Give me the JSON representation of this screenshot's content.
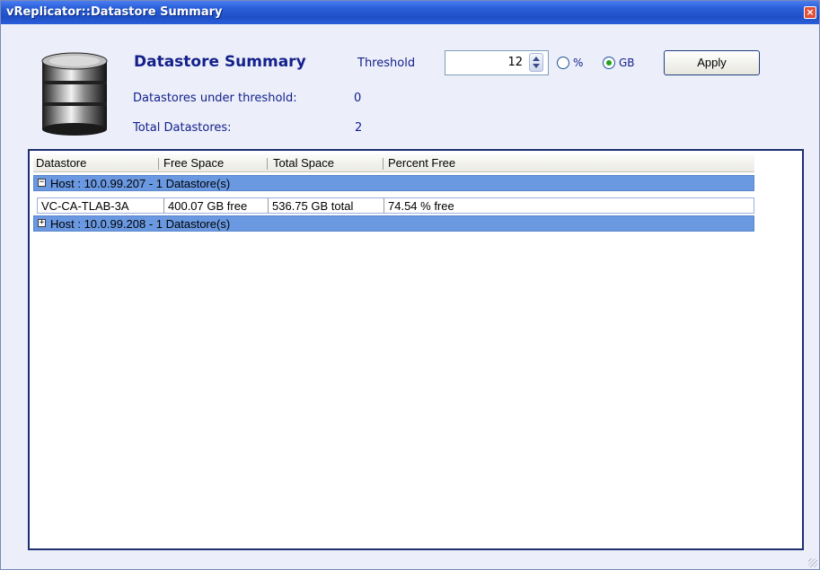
{
  "window": {
    "title": "vReplicator::Datastore Summary",
    "close_symbol": "×"
  },
  "summary": {
    "title": "Datastore Summary",
    "threshold_label": "Threshold",
    "threshold_value": "12",
    "percent_option_label": "%",
    "gb_option_label": "GB",
    "selected_unit": "GB",
    "apply_label": "Apply",
    "under_threshold_label": "Datastores under threshold:",
    "under_threshold_value": "0",
    "total_label": "Total Datastores:",
    "total_value": "2"
  },
  "grid": {
    "columns": [
      "Datastore",
      "Free Space",
      "Total Space",
      "Percent Free"
    ],
    "groups": [
      {
        "label": "Host : 10.0.99.207 - 1 Datastore(s)",
        "expanded": true,
        "toggle": "−",
        "rows": [
          {
            "datastore": "VC-CA-TLAB-3A",
            "free": "400.07 GB free",
            "total": "536.75 GB total",
            "percent": "74.54 % free"
          }
        ]
      },
      {
        "label": "Host : 10.0.99.208 - 1 Datastore(s)",
        "expanded": false,
        "toggle": "+",
        "rows": []
      }
    ]
  },
  "colors": {
    "title_blue": "#14208c",
    "group_row": "#6a99e2",
    "window_bg": "#eceff9"
  }
}
